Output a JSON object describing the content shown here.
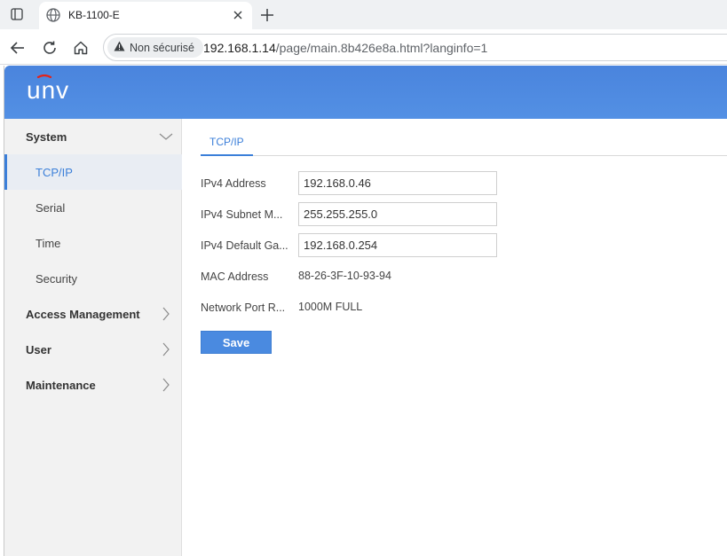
{
  "browser": {
    "tab_title": "KB-1100-E",
    "security_label": "Non sécurisé",
    "url_host": "192.168.1.14",
    "url_path": "/page/main.8b426e8a.html?langinfo=1"
  },
  "app": {
    "logo_text": "unv",
    "brand_color": "#4a84dd"
  },
  "sidebar": {
    "groups": [
      {
        "label": "System",
        "expanded": true,
        "icon": "chevron-down-icon"
      },
      {
        "label": "Access Management",
        "expanded": false,
        "icon": "chevron-right-icon"
      },
      {
        "label": "User",
        "expanded": false,
        "icon": "chevron-right-icon"
      },
      {
        "label": "Maintenance",
        "expanded": false,
        "icon": "chevron-right-icon"
      }
    ],
    "system_items": [
      {
        "label": "TCP/IP",
        "active": true
      },
      {
        "label": "Serial",
        "active": false
      },
      {
        "label": "Time",
        "active": false
      },
      {
        "label": "Security",
        "active": false
      }
    ]
  },
  "content": {
    "tab_label": "TCP/IP",
    "fields": {
      "ipv4_address": {
        "label": "IPv4 Address",
        "value": "192.168.0.46"
      },
      "subnet_mask": {
        "label": "IPv4 Subnet M...",
        "value": "255.255.255.0"
      },
      "default_gateway": {
        "label": "IPv4 Default Ga...",
        "value": "192.168.0.254"
      },
      "mac_address": {
        "label": "MAC Address",
        "value": "88-26-3F-10-93-94"
      },
      "network_port_rate": {
        "label": "Network Port R...",
        "value": "1000M FULL"
      }
    },
    "save_label": "Save"
  }
}
